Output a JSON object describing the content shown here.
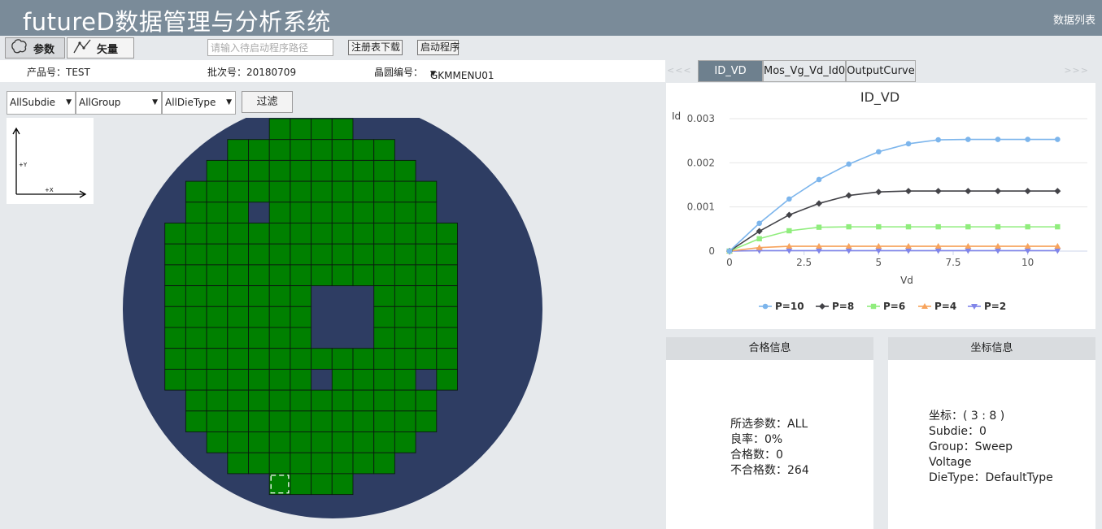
{
  "header": {
    "title": "futureD数据管理与分析系统",
    "right_link": "数据列表"
  },
  "toolbar": {
    "param_label": "参数",
    "vector_label": "矢量",
    "path_placeholder": "请输入待启动程序路径",
    "register_download_label": "注册表下载",
    "launch_label": "启动程序"
  },
  "info_bar": {
    "product": "产品号：TEST",
    "batch": "批次号：20180709",
    "wafer_label": "晶圆编号：",
    "wafer_value": "GKMMENU01"
  },
  "filters": {
    "subdie": "AllSubdie",
    "group": "AllGroup",
    "dietype": "AllDieType",
    "filter_label": "过滤"
  },
  "axis_indicator": {
    "y_label": "+Y",
    "x_label": "+X"
  },
  "wafer_map": {
    "colors": {
      "pass_die": "#008000",
      "wafer_bg": "#2e3d63",
      "grid_line": "#0b1a10",
      "selected": "#ffffff"
    },
    "rows": [
      {
        "start": 6,
        "end": 9
      },
      {
        "start": 4,
        "end": 11
      },
      {
        "start": 3,
        "end": 12
      },
      {
        "start": 2,
        "end": 13
      },
      {
        "start": 2,
        "end": 13
      },
      {
        "start": 1,
        "end": 14
      },
      {
        "start": 1,
        "end": 14
      },
      {
        "start": 1,
        "end": 14
      },
      {
        "start": 1,
        "end": 14
      },
      {
        "start": 1,
        "end": 14
      },
      {
        "start": 1,
        "end": 14
      },
      {
        "start": 1,
        "end": 14
      },
      {
        "start": 1,
        "end": 14
      },
      {
        "start": 2,
        "end": 13
      },
      {
        "start": 2,
        "end": 13
      },
      {
        "start": 3,
        "end": 12
      },
      {
        "start": 4,
        "end": 11
      },
      {
        "start": 6,
        "end": 9
      }
    ],
    "missing": [
      [
        5,
        4
      ],
      [
        8,
        8
      ],
      [
        8,
        9
      ],
      [
        8,
        10
      ],
      [
        8,
        12
      ],
      [
        9,
        8
      ],
      [
        9,
        9
      ],
      [
        9,
        10
      ],
      [
        10,
        8
      ],
      [
        10,
        9
      ],
      [
        10,
        10
      ],
      [
        13,
        12
      ]
    ],
    "selected": [
      6,
      17
    ]
  },
  "tabs": {
    "items": [
      "ID_VD",
      "Mos_Vg_Vd_Id0",
      "OutputCurve"
    ],
    "prev_arrow": "<<<",
    "next_arrow": ">>>"
  },
  "chart_data": {
    "type": "line",
    "title": "ID_VD",
    "xlabel": "Vd",
    "ylabel": "Id",
    "xlim": [
      0,
      12
    ],
    "ylim": [
      0,
      0.003
    ],
    "x_ticks": [
      0,
      2.5,
      5,
      7.5,
      10
    ],
    "y_ticks": [
      0,
      0.001,
      0.002,
      0.003
    ],
    "x_tick_labels": [
      "0",
      "2.5",
      "5",
      "7.5",
      "10"
    ],
    "y_tick_labels": [
      "0",
      "0.001",
      "0.002",
      "0.003"
    ],
    "grid": "horizontal",
    "legend": "bottom",
    "x": [
      0,
      1,
      2,
      3,
      4,
      5,
      6,
      7,
      8,
      9,
      10,
      11
    ],
    "series": [
      {
        "name": "P=10",
        "color": "#7cb5ec",
        "marker": "circle",
        "values": [
          0,
          0.00063,
          0.00118,
          0.00162,
          0.00197,
          0.00225,
          0.00243,
          0.00252,
          0.00253,
          0.00253,
          0.00253,
          0.00253
        ]
      },
      {
        "name": "P=8",
        "color": "#434348",
        "marker": "diamond",
        "values": [
          0,
          0.00045,
          0.00082,
          0.00108,
          0.00126,
          0.00134,
          0.00136,
          0.00136,
          0.00136,
          0.00136,
          0.00136,
          0.00136
        ]
      },
      {
        "name": "P=6",
        "color": "#90ed7d",
        "marker": "square",
        "values": [
          0,
          0.00028,
          0.00046,
          0.00054,
          0.00055,
          0.00055,
          0.00055,
          0.00055,
          0.00055,
          0.00055,
          0.00055,
          0.00055
        ]
      },
      {
        "name": "P=4",
        "color": "#f7a35c",
        "marker": "triangle",
        "values": [
          0,
          8e-05,
          0.00011,
          0.00011,
          0.00011,
          0.00011,
          0.00011,
          0.00011,
          0.00011,
          0.00011,
          0.00011,
          0.00011
        ]
      },
      {
        "name": "P=2",
        "color": "#8085e9",
        "marker": "triangle-down",
        "values": [
          0,
          1e-05,
          1e-05,
          1e-05,
          1e-05,
          1e-05,
          1e-05,
          1e-05,
          1e-05,
          1e-05,
          1e-05,
          1e-05
        ]
      }
    ]
  },
  "qualify_panel": {
    "title": "合格信息",
    "lines": [
      "所选参数：ALL",
      "良率：0%",
      "合格数：0",
      "不合格数：264"
    ]
  },
  "coord_panel": {
    "title": "坐标信息",
    "lines": [
      "坐标：( 3 : 8 )",
      "Subdie：0",
      "Group：Sweep",
      "Voltage",
      "DieType：DefaultType"
    ]
  }
}
